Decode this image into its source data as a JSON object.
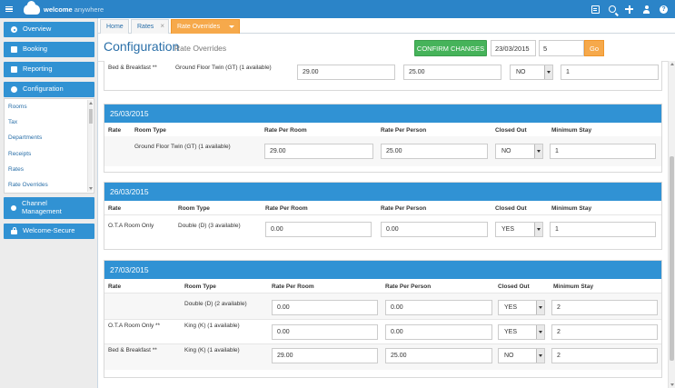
{
  "topbar": {
    "brand": "welcome",
    "brand_suffix": "anywhere"
  },
  "sidebar": {
    "nav": [
      {
        "label": "Overview",
        "icon": "overview-icon"
      },
      {
        "label": "Booking",
        "icon": "booking-icon"
      },
      {
        "label": "Reporting",
        "icon": "reporting-icon"
      },
      {
        "label": "Configuration",
        "icon": "configuration-icon"
      },
      {
        "label": "Channel Management",
        "icon": "channel-icon"
      },
      {
        "label": "Welcome-Secure",
        "icon": "lock-icon"
      }
    ],
    "submenu": [
      "Rooms",
      "Tax",
      "Departments",
      "Receipts",
      "Rates",
      "Rate Overrides"
    ]
  },
  "tabs": [
    {
      "label": "Home"
    },
    {
      "label": "Rates"
    },
    {
      "label": "Rate Overrides"
    }
  ],
  "header": {
    "title": "Configuration",
    "subtitle": "Rate Overrides",
    "confirm_label": "CONFIRM CHANGES",
    "date_value": "23/03/2015",
    "days_value": "5",
    "go_label": "Go"
  },
  "columns": {
    "rate": "Rate",
    "room_type": "Room Type",
    "rate_per_room": "Rate Per Room",
    "rate_per_person": "Rate Per Person",
    "closed_out": "Closed Out",
    "minimum_stay": "Minimum Stay"
  },
  "top_partial": {
    "rate": "Bed & Breakfast **",
    "room_type": "Ground Floor Twin (GT) (1 available)",
    "rate_per_room": "29.00",
    "rate_per_person": "25.00",
    "closed_out": "NO",
    "minimum_stay": "1"
  },
  "sections": [
    {
      "date": "25/03/2015",
      "rows": [
        {
          "rate": "",
          "room_type": "Ground Floor Twin (GT) (1 available)",
          "rate_per_room": "29.00",
          "rate_per_person": "25.00",
          "closed_out": "NO",
          "minimum_stay": "1"
        }
      ]
    },
    {
      "date": "26/03/2015",
      "rows": [
        {
          "rate": "O.T.A Room Only",
          "room_type": "Double (D) (3 available)",
          "rate_per_room": "0.00",
          "rate_per_person": "0.00",
          "closed_out": "YES",
          "minimum_stay": "1"
        }
      ]
    },
    {
      "date": "27/03/2015",
      "rows": [
        {
          "rate": "",
          "room_type": "Double (D) (2 available)",
          "rate_per_room": "0.00",
          "rate_per_person": "0.00",
          "closed_out": "YES",
          "minimum_stay": "2"
        },
        {
          "rate": "O.T.A Room Only **",
          "room_type": "King (K) (1 available)",
          "rate_per_room": "0.00",
          "rate_per_person": "0.00",
          "closed_out": "YES",
          "minimum_stay": "2"
        },
        {
          "rate": "Bed & Breakfast **",
          "room_type": "King (K) (1 available)",
          "rate_per_room": "29.00",
          "rate_per_person": "25.00",
          "closed_out": "NO",
          "minimum_stay": "2"
        }
      ]
    }
  ]
}
